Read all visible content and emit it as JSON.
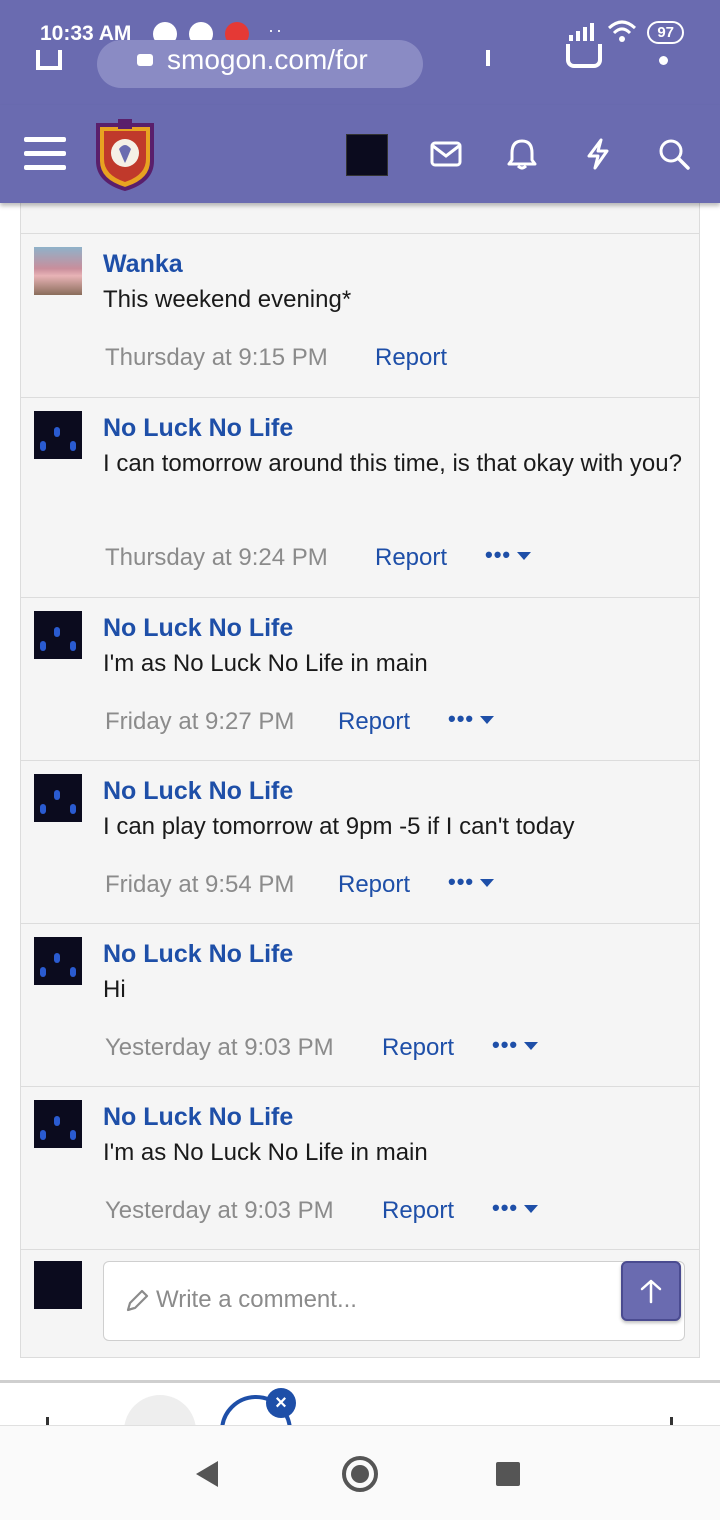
{
  "status_bar": {
    "time": "10:33 AM",
    "battery": "97"
  },
  "browser": {
    "url": "smogon.com/for"
  },
  "header": {
    "menu_icon": "hamburger-icon",
    "logo": "smogon-logo",
    "icons": [
      "mail-icon",
      "bell-icon",
      "bolt-icon",
      "search-icon"
    ]
  },
  "comments": [
    {
      "name": "Wanka",
      "text": "This weekend evening*",
      "time": "Thursday at 9:15 PM",
      "report": "Report",
      "has_more": false
    },
    {
      "name": "No Luck No Life",
      "text": "I can tomorrow around this time, is that okay with you?",
      "time": "Thursday at 9:24 PM",
      "report": "Report",
      "has_more": true
    },
    {
      "name": "No Luck No Life",
      "text": "I'm as No Luck No Life in main",
      "time": "Friday at 9:27 PM",
      "report": "Report",
      "has_more": true
    },
    {
      "name": "No Luck No Life",
      "text": "I can play tomorrow at 9pm -5 if I can't today",
      "time": "Friday at 9:54 PM",
      "report": "Report",
      "has_more": true
    },
    {
      "name": "No Luck No Life",
      "text": "Hi",
      "time": "Yesterday at 9:03 PM",
      "report": "Report",
      "has_more": true
    },
    {
      "name": "No Luck No Life",
      "text": "I'm as No Luck No Life in main",
      "time": "Yesterday at 9:03 PM",
      "report": "Report",
      "has_more": true
    }
  ],
  "composer": {
    "placeholder": "Write a comment..."
  },
  "more_label": "•••",
  "colors": {
    "header_bg": "#6a6bb0",
    "link": "#1e4fa8",
    "meta": "#8b8b8b"
  }
}
